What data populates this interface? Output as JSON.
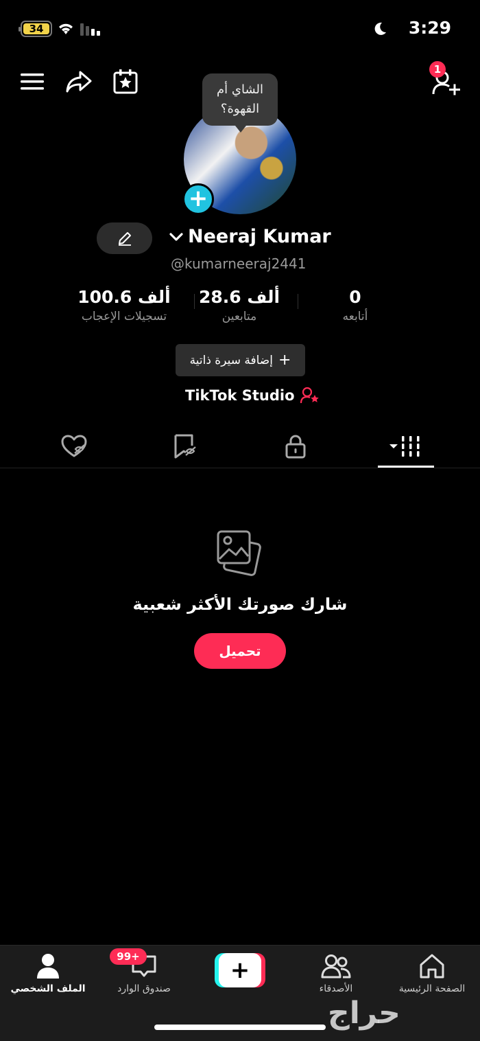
{
  "status_bar": {
    "battery": "34",
    "time": "3:29"
  },
  "header": {
    "follow_requests_count": "1"
  },
  "profile": {
    "bubble_text_line1": "الشاي أم",
    "bubble_text_line2": "القهوة؟",
    "name": "Neeraj Kumar",
    "username": "@kumarneeraj2441",
    "stats": {
      "likes": {
        "value": "100.6 ألف",
        "label": "تسجيلات الإعجاب"
      },
      "followers": {
        "value": "28.6 ألف",
        "label": "متابعين"
      },
      "following": {
        "value": "0",
        "label": "أتابعه"
      }
    },
    "add_bio_label": "إضافة سيرة ذاتية",
    "studio_label": "TikTok Studio"
  },
  "empty_state": {
    "title": "شارك صورتك الأكثر شعبية",
    "upload_label": "تحميل"
  },
  "bottom_nav": {
    "profile": "الملف الشخصي",
    "inbox": "صندوق الوارد",
    "inbox_badge": "99+",
    "friends": "الأصدقاء",
    "home": "الصفحة الرئيسية"
  },
  "watermark": "حراج",
  "colors": {
    "accent": "#fe2c55",
    "cyan": "#25f4ee",
    "battery": "#f2d34a"
  }
}
